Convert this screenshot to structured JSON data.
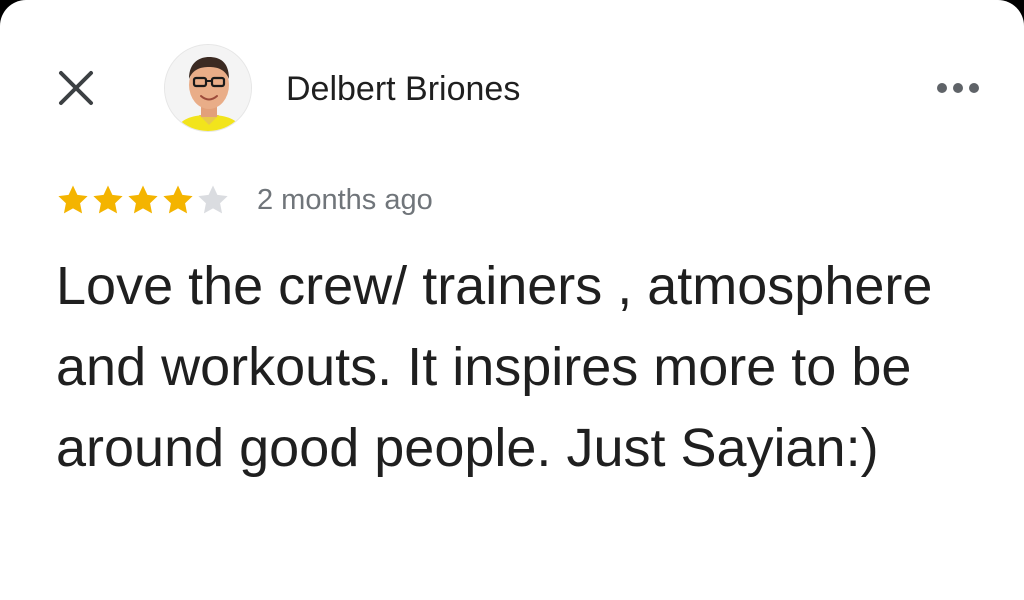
{
  "review": {
    "author_name": "Delbert Briones",
    "avatar_icon": "profile-photo",
    "rating": 4,
    "rating_max": 5,
    "time_ago": "2 months ago",
    "text": "Love the crew/ trainers , atmosphere and workouts. It inspires more to be around good people. Just Sayian:)"
  },
  "icons": {
    "close": "close-icon",
    "more": "more-horizontal-icon",
    "star_filled": "star-icon"
  },
  "colors": {
    "star_filled": "#F4B400",
    "star_empty": "#DADCE0",
    "secondary_text": "#70757A",
    "primary_text": "#1F1F1F"
  }
}
